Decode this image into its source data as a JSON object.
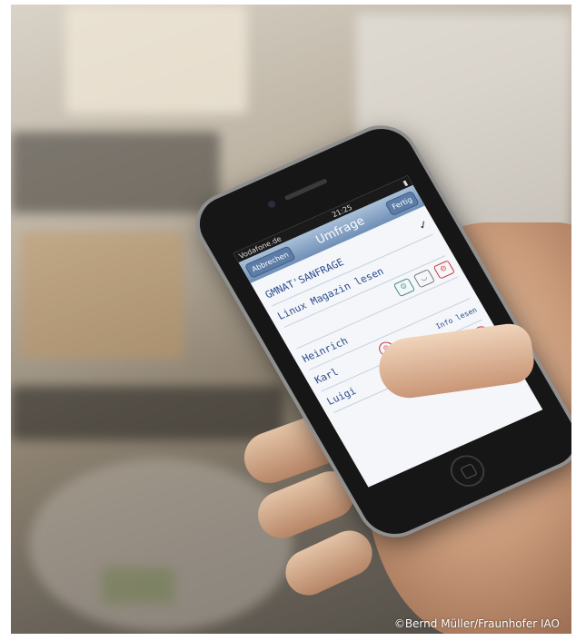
{
  "photo": {
    "credit": "©Bernd Müller/Fraunhofer IAO"
  },
  "phone_screen": {
    "status": {
      "carrier": "Vodafone.de",
      "time": "21:25"
    },
    "nav": {
      "left_button": "Abbrechen",
      "title": "Umfrage",
      "right_button": "Fertig"
    },
    "handwriting": {
      "line1": "GMNAT'SANFRAGE",
      "line2": "Linux Magazin lesen",
      "name1": "Heinrich",
      "name2": "Karl",
      "name3": "Luigi",
      "note": "Info lesen"
    }
  },
  "colors": {
    "nav_bar": "#6f8fb6",
    "ink": "#2a4a8a",
    "smiley_red": "#cc3333",
    "smiley_green": "#3a8a8a"
  }
}
